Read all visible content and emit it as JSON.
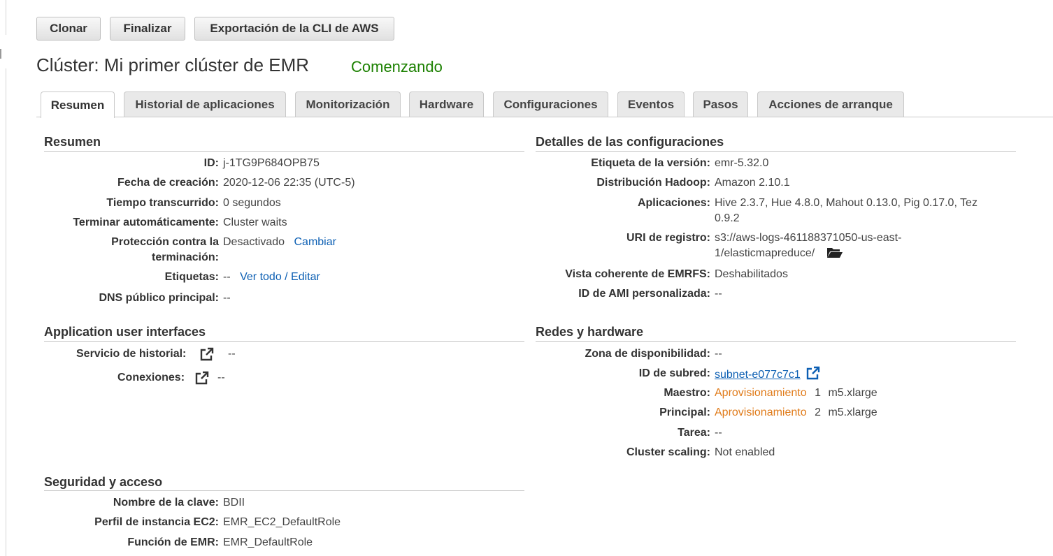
{
  "toolbar": {
    "clone": "Clonar",
    "finish": "Finalizar",
    "export": "Exportación de la CLI de AWS"
  },
  "cluster": {
    "title": "Clúster: Mi primer clúster de EMR",
    "status": "Comenzando"
  },
  "tabs": [
    "Resumen",
    "Historial de aplicaciones",
    "Monitorización",
    "Hardware",
    "Configuraciones",
    "Eventos",
    "Pasos",
    "Acciones de arranque"
  ],
  "summary": {
    "title": "Resumen",
    "id_label": "ID:",
    "id_value": "j-1TG9P684OPB75",
    "created_label": "Fecha de creación:",
    "created_value": "2020-12-06 22:35 (UTC-5)",
    "elapsed_label": "Tiempo transcurrido:",
    "elapsed_value": "0 segundos",
    "autoterm_label": "Terminar automáticamente:",
    "autoterm_value": "Cluster waits",
    "protect_label_1": "Protección contra la",
    "protect_label_2": "terminación:",
    "protect_value": "Desactivado",
    "protect_action": "Cambiar",
    "tags_label": "Etiquetas:",
    "tags_value": "--",
    "tags_action": "Ver todo / Editar",
    "dns_label": "DNS público principal:",
    "dns_value": "--"
  },
  "config": {
    "title": "Detalles de las configuraciones",
    "release_label": "Etiqueta de la versión:",
    "release_value": "emr-5.32.0",
    "hadoop_label": "Distribución Hadoop:",
    "hadoop_value": "Amazon 2.10.1",
    "apps_label": "Aplicaciones:",
    "apps_value_1": "Hive 2.3.7, Hue 4.8.0, Mahout 0.13.0, Pig 0.17.0, Tez",
    "apps_value_2": "0.9.2",
    "log_label": "URI de registro:",
    "log_value_1": "s3://aws-logs-461188371050-us-east-",
    "log_value_2": "1/elasticmapreduce/",
    "emrfs_label": "Vista coherente de EMRFS:",
    "emrfs_value": "Deshabilitados",
    "ami_label": "ID de AMI personalizada:",
    "ami_value": "--"
  },
  "app_ui": {
    "title": "Application user interfaces",
    "history_label": "Servicio de historial:",
    "history_value": "--",
    "connections_label": "Conexiones:",
    "connections_value": "--"
  },
  "network": {
    "title": "Redes y hardware",
    "az_label": "Zona de disponibilidad:",
    "az_value": "--",
    "subnet_label": "ID de subred:",
    "subnet_value": "subnet-e077c7c1",
    "master_label": "Maestro:",
    "master_status": "Aprovisionamiento",
    "master_count": "1",
    "master_type": "m5.xlarge",
    "core_label": "Principal:",
    "core_status": "Aprovisionamiento",
    "core_count": "2",
    "core_type": "m5.xlarge",
    "task_label": "Tarea:",
    "task_value": "--",
    "scaling_label": "Cluster scaling:",
    "scaling_value": "Not enabled"
  },
  "security": {
    "title": "Seguridad y acceso",
    "key_label": "Nombre de la clave:",
    "key_value": "BDII",
    "profile_label": "Perfil de instancia EC2:",
    "profile_value": "EMR_EC2_DefaultRole",
    "role_label": "Función de EMR:",
    "role_value": "EMR_DefaultRole"
  },
  "colors": {
    "status_green": "#1d8102",
    "link_blue": "#0c5fb3",
    "provisioning_orange": "#e07b1a"
  }
}
